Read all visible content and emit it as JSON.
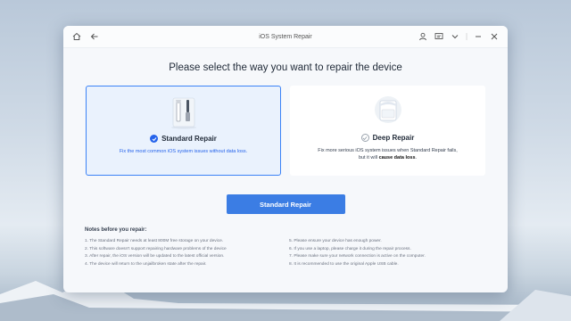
{
  "window": {
    "title": "iOS System Repair"
  },
  "heading": "Please select the way you want to repair the device",
  "cards": [
    {
      "title": "Standard Repair",
      "desc": "Fix the most common iOS system issues without data loss.",
      "selected": true
    },
    {
      "title": "Deep Repair",
      "desc_pre": "Fix more serious iOS system issues when Standard Repair fails, but it will ",
      "desc_bold": "cause data loss",
      "desc_post": ".",
      "selected": false
    }
  ],
  "primary_button": "Standard Repair",
  "notes": {
    "title": "Notes before you repair:",
    "left": [
      "1. The Standard Repair needs at least 800M free storage on your device.",
      "2. This software doesn't support repairing hardware problems of the device",
      "3. After repair, the iOS version will be updated to the latest official version.",
      "4. The device will return to the unjailbroken state after the repair."
    ],
    "right": [
      "5. Please ensure your device has enough power.",
      "6. If you use a laptop, please charge it during the repair process.",
      "7. Please make sure your network connection is active on the computer.",
      "8. It is recommended to use the original Apple USB cable."
    ]
  },
  "colors": {
    "accent": "#3b7de4",
    "selected_bg": "#eaf2fd",
    "selected_border": "#3b82f6"
  },
  "icons": [
    "home-icon",
    "back-arrow-icon",
    "account-icon",
    "feedback-icon",
    "menu-chevron-icon",
    "minimize-icon",
    "close-icon"
  ]
}
